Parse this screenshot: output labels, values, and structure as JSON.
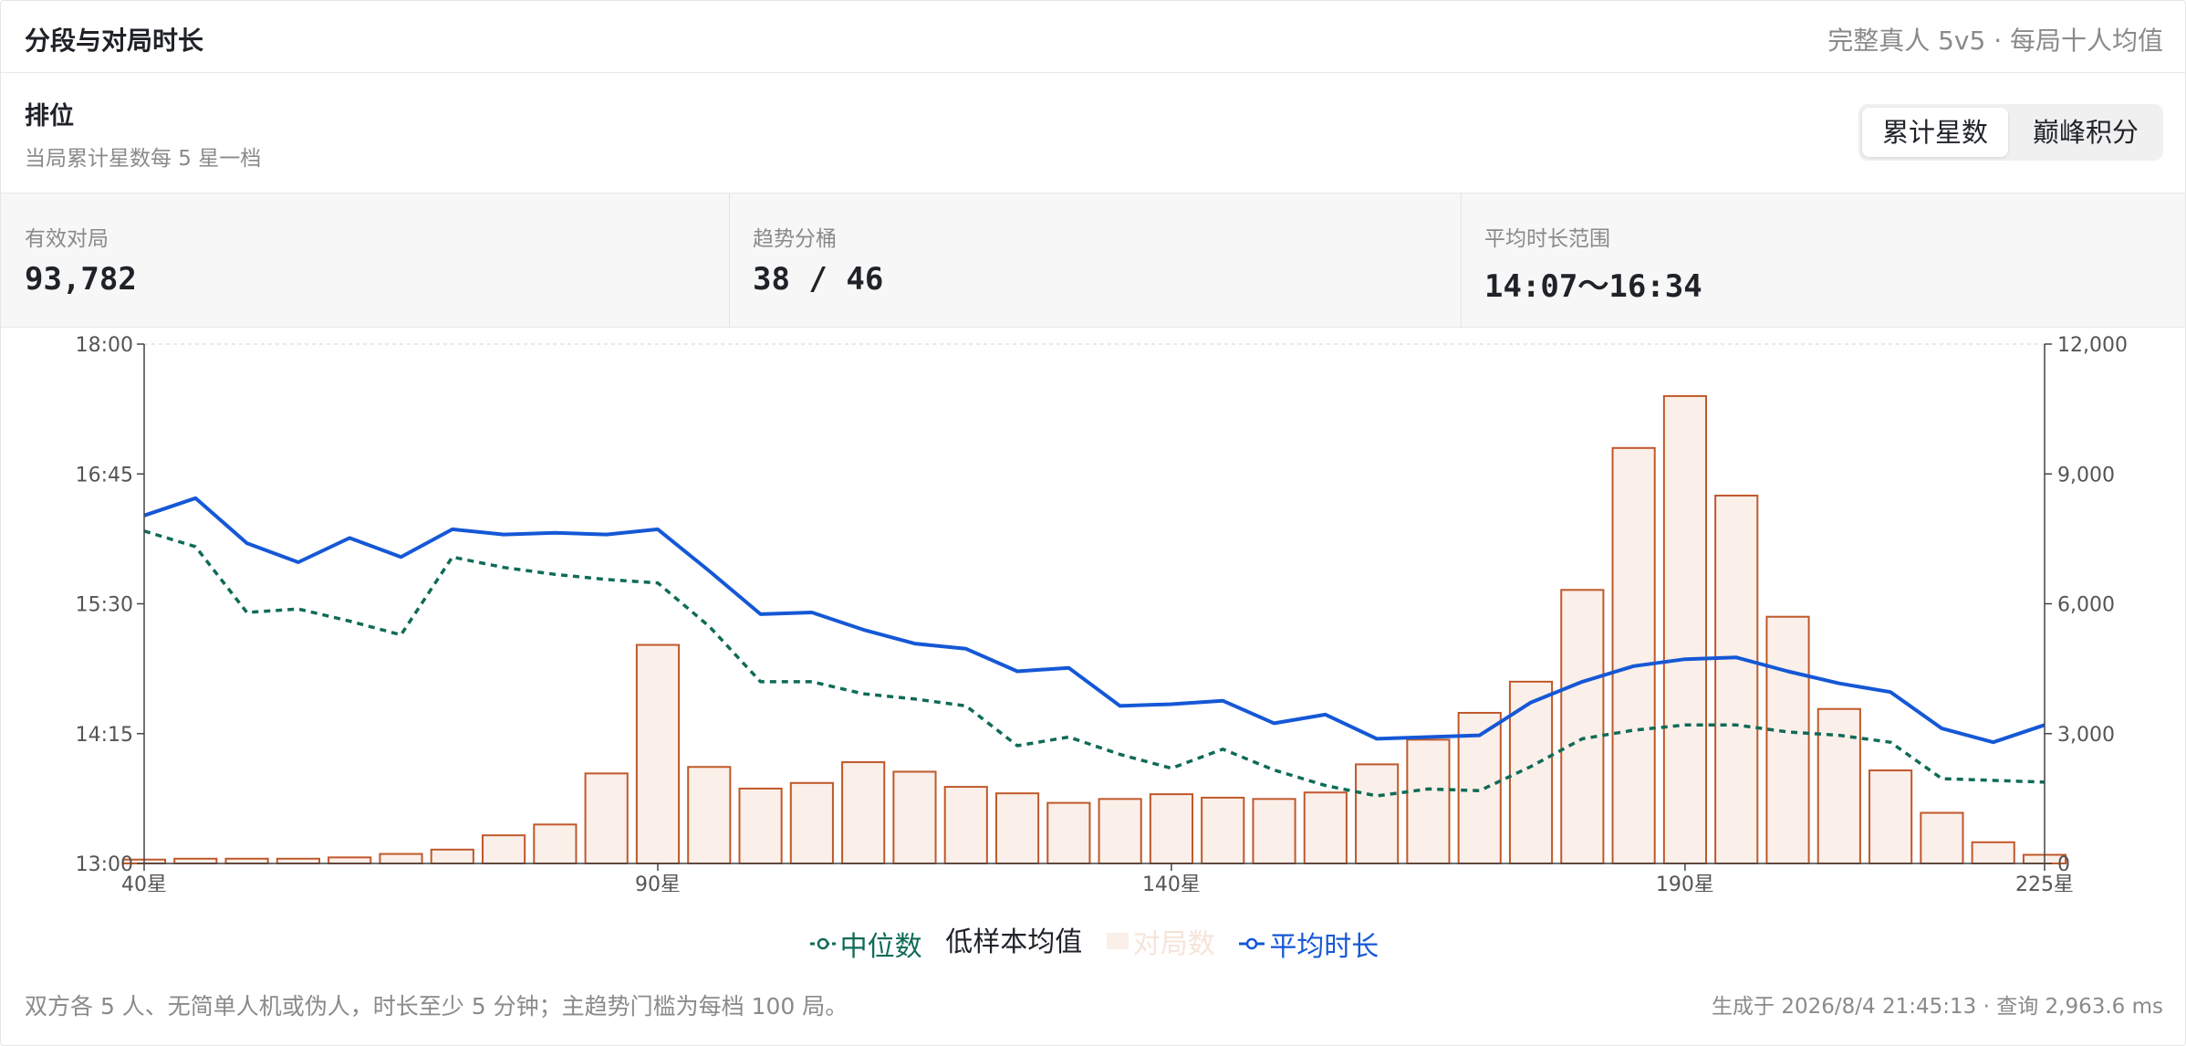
{
  "header": {
    "title": "分段与对局时长",
    "subtitle": "完整真人 5v5 · 每局十人均值"
  },
  "section": {
    "title": "排位",
    "subtitle": "当局累计星数每 5 星一档"
  },
  "toggle": {
    "options": [
      "累计星数",
      "巅峰积分"
    ],
    "selected": "累计星数"
  },
  "stats": [
    {
      "label": "有效对局",
      "value": "93,782"
    },
    {
      "label": "趋势分桶",
      "value": "38 / 46"
    },
    {
      "label": "平均时长范围",
      "value": "14:07～16:34"
    }
  ],
  "legend": {
    "median": "中位数",
    "low_sample": "低样本均值",
    "games": "对局数",
    "mean": "平均时长"
  },
  "footer": {
    "note": "双方各 5 人、无简单人机或伪人，时长至少 5 分钟；主趋势门槛为每档 100 局。",
    "generated": "生成于 2026/8/4 21:45:13 · 查询 2,963.6 ms"
  },
  "colors": {
    "mean": "#1558d6",
    "median": "#0f6b57",
    "bar_stroke": "#c0582a",
    "bar_fill": "#fbefe9"
  },
  "chart_data": {
    "type": "bar",
    "x_tick_labels": [
      "40星",
      "90星",
      "140星",
      "190星",
      "225星"
    ],
    "x_tick_positions": [
      40,
      90,
      140,
      190,
      225
    ],
    "x_range": [
      40,
      225
    ],
    "left_axis": {
      "ticks": [
        "13:00",
        "14:15",
        "15:30",
        "16:45",
        "18:00"
      ],
      "range_seconds": [
        46800,
        64800
      ]
    },
    "right_axis": {
      "ticks": [
        "0",
        "3,000",
        "6,000",
        "9,000",
        "12,000"
      ],
      "range": [
        0,
        12000
      ]
    },
    "x": [
      40,
      45,
      50,
      55,
      60,
      65,
      70,
      75,
      80,
      85,
      90,
      95,
      100,
      105,
      110,
      115,
      120,
      125,
      130,
      135,
      140,
      145,
      150,
      155,
      160,
      165,
      170,
      175,
      180,
      185,
      190,
      195,
      200,
      205,
      210,
      215,
      220,
      225
    ],
    "series": [
      {
        "name": "对局数",
        "type": "bar",
        "axis": "right",
        "values": [
          90,
          110,
          110,
          110,
          140,
          220,
          320,
          650,
          900,
          2080,
          5050,
          2230,
          1730,
          1860,
          2340,
          2120,
          1770,
          1620,
          1400,
          1490,
          1600,
          1520,
          1490,
          1640,
          2290,
          2860,
          3480,
          4200,
          6320,
          9600,
          10800,
          8500,
          5700,
          3570,
          2150,
          1170,
          490,
          200
        ]
      },
      {
        "name": "中位数",
        "type": "line",
        "axis": "left",
        "values": [
          "16:12",
          "16:03",
          "15:25",
          "15:27",
          "15:20",
          "15:12",
          "15:57",
          "15:51",
          "15:47",
          "15:44",
          "15:42",
          "15:17",
          "14:45",
          "14:45",
          "14:38",
          "14:35",
          "14:31",
          "14:08",
          "14:13",
          "14:03",
          "13:55",
          "14:06",
          "13:54",
          "13:45",
          "13:39",
          "13:43",
          "13:42",
          "13:56",
          "14:12",
          "14:17",
          "14:20",
          "14:20",
          "14:16",
          "14:14",
          "14:10",
          "13:49",
          "13:48",
          "13:47"
        ]
      },
      {
        "name": "平均时长",
        "type": "line",
        "axis": "left",
        "values": [
          "16:21",
          "16:31",
          "16:05",
          "15:54",
          "16:08",
          "15:57",
          "16:13",
          "16:10",
          "16:11",
          "16:10",
          "16:13",
          "15:49",
          "15:24",
          "15:25",
          "15:15",
          "15:07",
          "15:04",
          "14:51",
          "14:53",
          "14:31",
          "14:32",
          "14:34",
          "14:21",
          "14:26",
          "14:12",
          "14:13",
          "14:14",
          "14:33",
          "14:45",
          "14:54",
          "14:58",
          "14:59",
          "14:51",
          "14:44",
          "14:39",
          "14:18",
          "14:10",
          "14:20"
        ]
      }
    ]
  }
}
